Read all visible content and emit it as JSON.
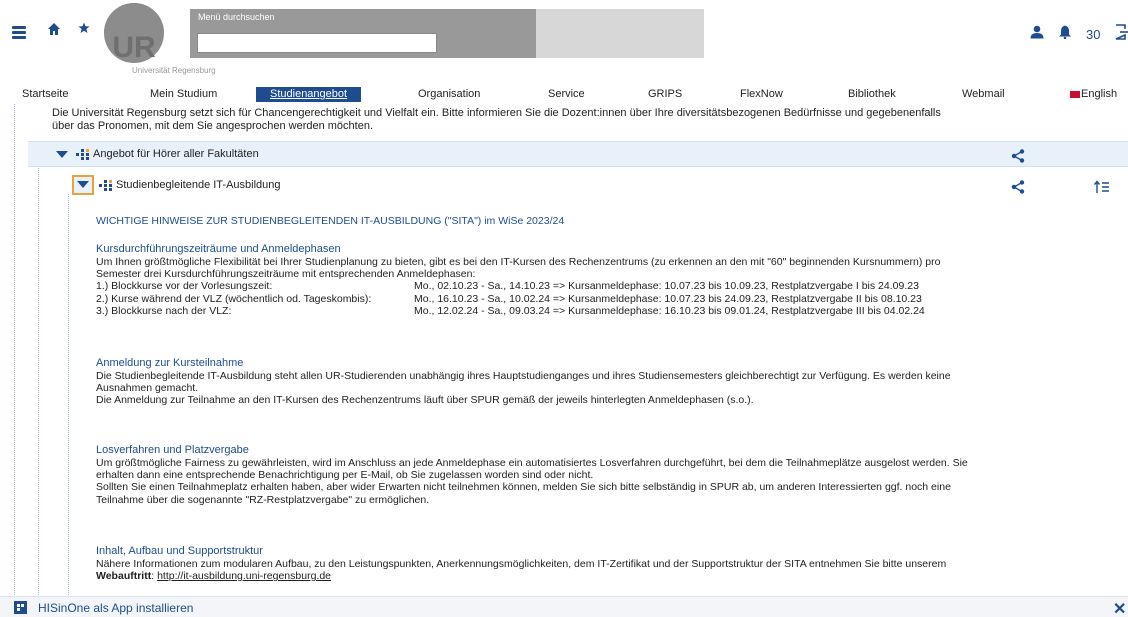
{
  "header": {
    "logo_text": "UR",
    "logo_subtitle": "Universität Regensburg",
    "search_label": "Menü durchsuchen",
    "search_value": "",
    "timer": "30"
  },
  "nav": {
    "items": [
      {
        "label": "Startseite"
      },
      {
        "label": "Mein Studium"
      },
      {
        "label": "Studienangebot"
      },
      {
        "label": "Organisation"
      },
      {
        "label": "Service"
      },
      {
        "label": "GRIPS"
      },
      {
        "label": "FlexNow"
      },
      {
        "label": "Bibliothek"
      },
      {
        "label": "Webmail"
      },
      {
        "label": "English"
      }
    ],
    "active_color": "#1e4c8f"
  },
  "content": {
    "intro": "Die Universität Regensburg setzt sich für Chancengerechtigkeit und Vielfalt ein. Bitte informieren Sie die Dozent:innen über Ihre diversitätsbezogenen Bedürfnisse und gegebenenfalls über das Pronomen, mit dem Sie angesprochen werden möchten.",
    "tree": {
      "level1_label": "Angebot für Hörer aller Fakultäten",
      "level2_label": "Studienbegleitende IT-Ausbildung"
    },
    "caps_heading": "WICHTIGE HINWEISE ZUR STUDIENBEGLEITENDEN IT-AUSBILDUNG (\"SITA\") im  WiSe 2023/24",
    "sec1": {
      "title": "Kursdurchführungszeiträume und Anmeldephasen",
      "para": "Um Ihnen größtmögliche Flexibilität bei Ihrer Studienplanung zu bieten, gibt es bei den IT-Kursen des Rechenzentrums (zu erkennen an den mit \"60\" beginnenden Kursnummern) pro Semester drei Kursdurchführungszeiträume mit entsprechenden Anmeldephasen:",
      "rows": [
        {
          "a": "1.) Blockkurse vor der Vorlesungszeit:",
          "b": "Mo., 02.10.23 - Sa., 14.10.23  => Kursanmeldephase: 10.07.23 bis 10.09.23, Restplatzvergabe I bis 24.09.23"
        },
        {
          "a": "2.) Kurse während der VLZ (wöchentlich od. Tageskombis):",
          "b": "Mo., 16.10.23 - Sa., 10.02.24  => Kursanmeldephase: 10.07.23 bis 24.09.23, Restplatzvergabe II bis 08.10.23"
        },
        {
          "a": "3.) Blockkurse nach der VLZ:",
          "b": "Mo., 12.02.24 - Sa., 09.03.24  => Kursanmeldephase: 16.10.23 bis 09.01.24, Restplatzvergabe III bis 04.02.24"
        }
      ]
    },
    "sec2": {
      "title": "Anmeldung zur Kursteilnahme",
      "para1": "Die Studienbegleitende IT-Ausbildung steht allen UR-Studierenden unabhängig ihres Hauptstudienganges und ihres Studiensemesters gleichberechtigt zur Verfügung. Es werden keine Ausnahmen gemacht.",
      "para2": "Die Anmeldung zur Teilnahme an den IT-Kursen des Rechenzentrums läuft über SPUR gemäß der jeweils hinterlegten Anmeldephasen (s.o.)."
    },
    "sec3": {
      "title": "Losverfahren und Platzvergabe",
      "para1": "Um größtmögliche Fairness zu gewährleisten, wird im Anschluss an jede Anmeldephase ein automatisiertes Losverfahren durchgeführt, bei dem die Teilnahmeplätze ausgelost werden. Sie erhalten dann eine entsprechende Benachrichtigung per E-Mail, ob Sie zugelassen worden sind oder nicht.",
      "para2": "Sollten Sie einen Teilnahmeplatz erhalten haben, aber wider Erwarten nicht teilnehmen können, melden Sie sich bitte selbständig in SPUR ab, um anderen Interessierten ggf. noch eine Teilnahme über die sogenannte \"RZ-Restplatzvergabe\" zu ermöglichen."
    },
    "sec4": {
      "title": "Inhalt, Aufbau und Supportstruktur",
      "para": "Nähere Informationen zum modularen Aufbau, zu den Leistungspunkten, Anerkennungsmöglichkeiten, dem IT-Zertifikat und der Supportstruktur der SITA entnehmen Sie bitte unserem",
      "bold": "Webauftritt",
      "colon": ":",
      "link": "http://it-ausbildung.uni-regensburg.de"
    }
  },
  "bottom_bar": {
    "install_label": "HISinOne als App installieren"
  }
}
